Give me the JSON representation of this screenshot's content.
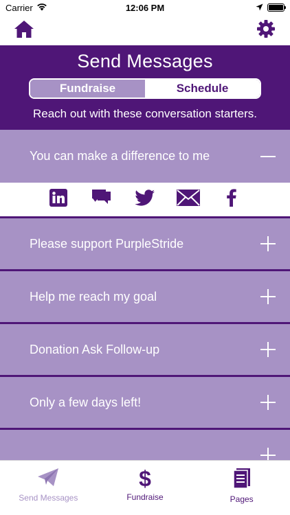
{
  "status_bar": {
    "carrier": "Carrier",
    "time": "12:06 PM"
  },
  "nav": {
    "home_icon": "home-icon",
    "settings_icon": "gear-icon"
  },
  "header": {
    "title": "Send Messages",
    "segments": [
      "Fundraise",
      "Schedule"
    ],
    "selected_segment": "Fundraise",
    "subtitle": "Reach out with these conversation starters."
  },
  "messages": [
    {
      "label": "You can make a difference to me",
      "expanded": true
    },
    {
      "label": "Please support PurpleStride",
      "expanded": false
    },
    {
      "label": "Help me reach my goal",
      "expanded": false
    },
    {
      "label": "Donation Ask Follow-up",
      "expanded": false
    },
    {
      "label": "Only a few days left!",
      "expanded": false
    },
    {
      "label": "",
      "expanded": false
    }
  ],
  "share_icons": [
    "linkedin-icon",
    "message-icon",
    "twitter-icon",
    "email-icon",
    "facebook-icon"
  ],
  "tab_bar": {
    "tabs": [
      {
        "label": "Send Messages",
        "icon": "paper-plane-icon",
        "active": false
      },
      {
        "label": "Fundraise",
        "icon": "dollar-icon",
        "active": true
      },
      {
        "label": "Pages",
        "icon": "document-icon",
        "active": false
      }
    ]
  },
  "colors": {
    "primary_purple": "#4f1677",
    "light_purple": "#a792c5",
    "white": "#ffffff"
  }
}
